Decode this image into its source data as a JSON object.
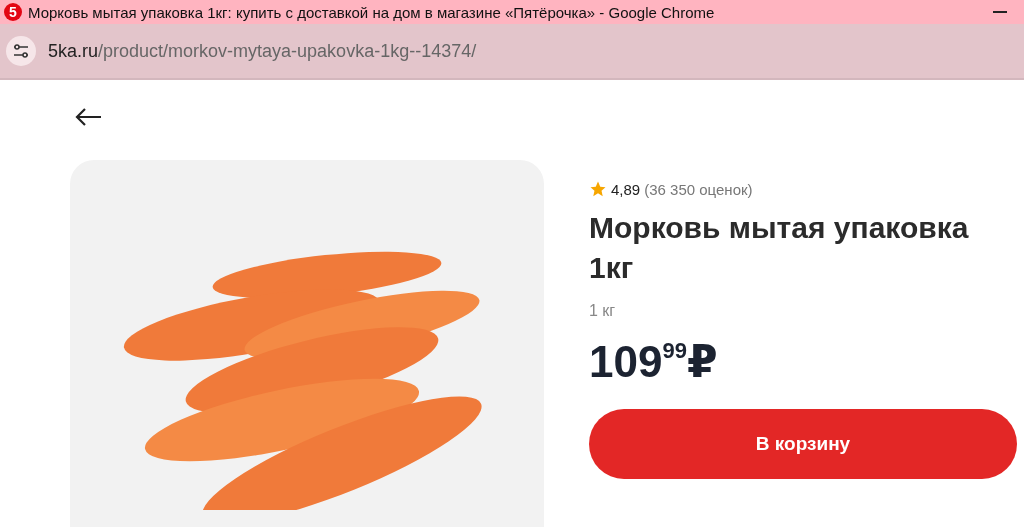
{
  "window": {
    "title": "Морковь мытая упаковка 1кг: купить с доставкой на дом в магазине «Пятёрочка» - Google Chrome",
    "app_logo": "5"
  },
  "address_bar": {
    "domain": "5ka.ru",
    "path": "/product/morkov-mytaya-upakovka-1kg--14374/"
  },
  "product": {
    "rating": "4,89",
    "reviews": "(36 350 оценок)",
    "title": "Морковь мытая упаковка 1кг",
    "weight": "1 кг",
    "price": "109$^{99}$₽",
    "button": "В корзину"
  }
}
